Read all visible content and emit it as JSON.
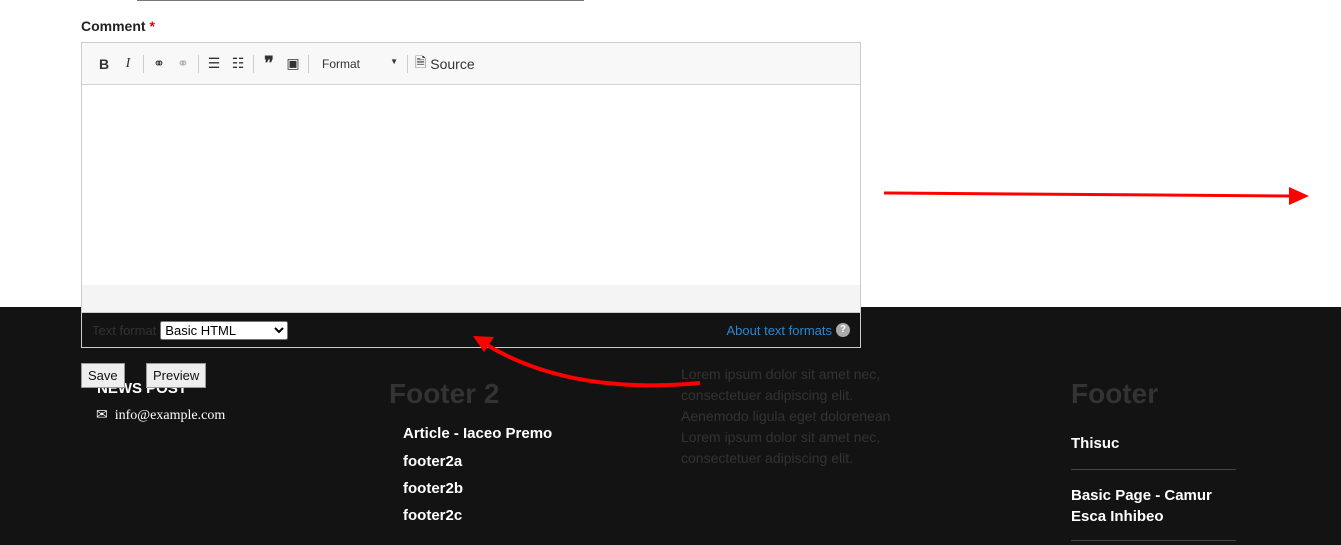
{
  "comment_label": "Comment",
  "required_mark": "*",
  "toolbar": {
    "bold": "B",
    "italic": "I",
    "format": "Format",
    "source": "Source"
  },
  "text_format": {
    "label": "Text format",
    "selected": "Basic HTML",
    "about": "About text formats",
    "help": "?"
  },
  "buttons": {
    "save": "Save",
    "preview": "Preview"
  },
  "footer": {
    "news_title": "NEWS POST",
    "email": "info@example.com",
    "footer2_title": "Footer 2",
    "footer2_links": [
      "Article - Iaceo Premo",
      "footer2a",
      "footer2b",
      "footer2c"
    ],
    "lorem": "Lorem ipsum dolor sit amet nec, consectetuer adipiscing elit. Aenemodo ligula eget dolorenean Lorem ipsum dolor sit amet nec, consectetuer adipiscing elit.",
    "footer3_title": "Footer",
    "footer3_links": [
      "Thisuc",
      "Basic Page - Camur Esca Inhibeo"
    ]
  },
  "annotation_color": "#ff0000"
}
